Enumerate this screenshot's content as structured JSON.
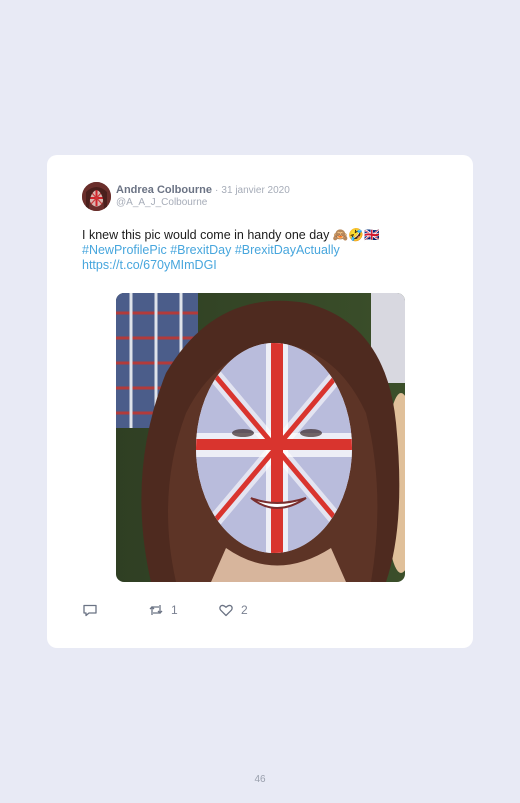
{
  "tweet": {
    "display_name": "Andrea Colbourne",
    "separator": "·",
    "date": "31 janvier 2020",
    "handle": "@A_A_J_Colbourne",
    "text_plain": "I knew this pic would come in handy one day ",
    "emoji": "🙈🤣🇬🇧",
    "hashtags": "#NewProfilePic #BrexitDay #BrexitDayActually",
    "link": "https://t.co/670yMImDGI",
    "retweet_count": "1",
    "like_count": "2",
    "image_subject": "face painted with Union Jack flag"
  },
  "page": {
    "number": "46"
  },
  "colors": {
    "background": "#e8eaf5",
    "card": "#ffffff",
    "link": "#47a6dd",
    "name": "#6b7384",
    "muted": "#a6acb8"
  },
  "icons": {
    "reply": "reply-icon",
    "retweet": "retweet-icon",
    "like": "heart-icon"
  }
}
